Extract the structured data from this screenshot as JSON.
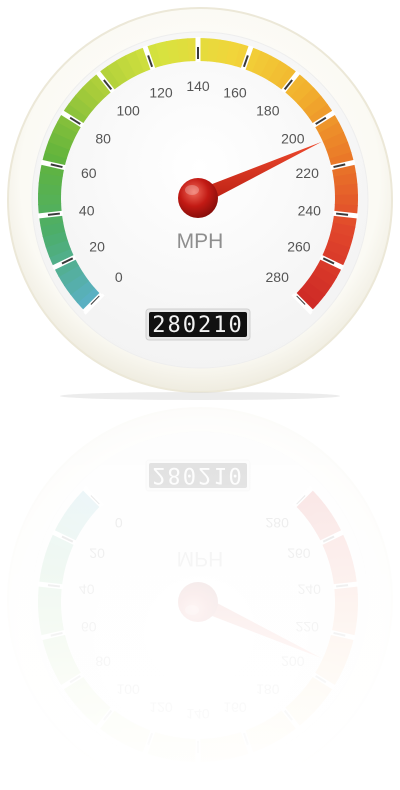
{
  "gauge": {
    "unit_label": "MPH",
    "odometer": "280210",
    "scale": {
      "min": 0,
      "max": 280,
      "major_step": 20,
      "labels": [
        "0",
        "20",
        "40",
        "60",
        "80",
        "100",
        "120",
        "140",
        "160",
        "180",
        "200",
        "220",
        "240",
        "260",
        "280"
      ]
    },
    "needle_value": 208,
    "colors": {
      "zone_gradient": [
        "#5ab0c2",
        "#4cae6a",
        "#62b43c",
        "#a8cc3a",
        "#d7e33f",
        "#f2d43a",
        "#f2b22e",
        "#ea7a28",
        "#e0452c",
        "#cf2b26"
      ],
      "needle": "#d22f1c",
      "hub": "#c21a14",
      "odometer_bg": "#111111",
      "odometer_text": "#f2f2f2",
      "label_text": "#555555",
      "mph_text": "#8e8e8e",
      "bezel": "#f7f5e9"
    }
  }
}
